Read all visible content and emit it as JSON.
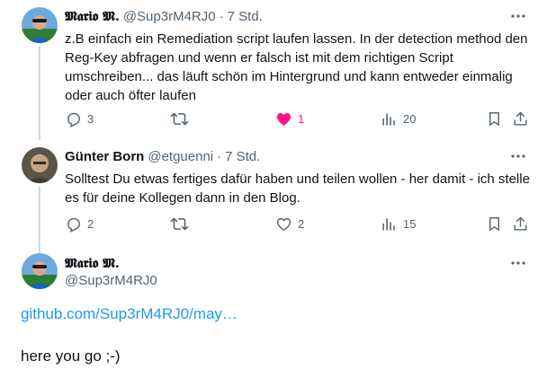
{
  "tweets": [
    {
      "display_name": "𝕸𝖆𝖗𝖎𝖔 𝕸.",
      "handle": "@Sup3rM4RJ0",
      "dot": "·",
      "time": "7 Std.",
      "text": "z.B einfach ein Remediation script laufen lassen. In der detection method den Reg-Key abfragen und wenn er falsch ist mit dem richtigen Script umschreiben... das läuft schön im Hintergrund und kann entweder einmalig oder auch öfter laufen",
      "replies": "3",
      "reposts": "",
      "likes": "1",
      "views": "20",
      "liked": true
    },
    {
      "display_name": "Günter Born",
      "handle": "@etguenni",
      "dot": "·",
      "time": "7 Std.",
      "text": "Solltest Du etwas fertiges dafür haben und teilen wollen - her damit - ich stelle es für deine Kollegen dann in den Blog.",
      "replies": "2",
      "reposts": "",
      "likes": "2",
      "views": "15",
      "liked": false
    },
    {
      "display_name": "𝕸𝖆𝖗𝖎𝖔 𝕸.",
      "handle": "@Sup3rM4RJ0",
      "link": "github.com/Sup3rM4RJ0/may…",
      "text": "here you go  ;-)"
    }
  ],
  "icons": {
    "more": "more-icon",
    "reply": "reply-icon",
    "repost": "repost-icon",
    "like": "heart-icon",
    "views": "views-icon",
    "bookmark": "bookmark-icon",
    "share": "share-icon"
  },
  "colors": {
    "like_active": "#f91880",
    "link": "#1d9bf0",
    "secondary_text": "#536471",
    "thread_line": "#cfd9de"
  }
}
